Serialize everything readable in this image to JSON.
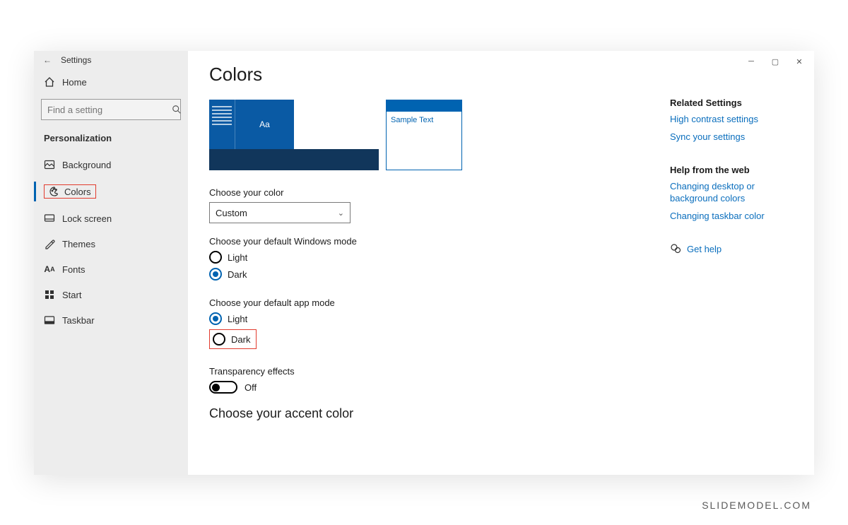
{
  "window": {
    "title": "Settings"
  },
  "sidebar": {
    "home": "Home",
    "search_placeholder": "Find a setting",
    "section": "Personalization",
    "items": [
      {
        "label": "Background"
      },
      {
        "label": "Colors",
        "selected": true,
        "highlighted": true
      },
      {
        "label": "Lock screen"
      },
      {
        "label": "Themes"
      },
      {
        "label": "Fonts"
      },
      {
        "label": "Start"
      },
      {
        "label": "Taskbar"
      }
    ]
  },
  "main": {
    "title": "Colors",
    "preview": {
      "tile_text": "Aa",
      "sample_text": "Sample Text"
    },
    "choose_color": {
      "label": "Choose your color",
      "value": "Custom"
    },
    "windows_mode": {
      "label": "Choose your default Windows mode",
      "options": [
        {
          "label": "Light",
          "selected": false
        },
        {
          "label": "Dark",
          "selected": true
        }
      ]
    },
    "app_mode": {
      "label": "Choose your default app mode",
      "options": [
        {
          "label": "Light",
          "selected": true,
          "highlighted": false
        },
        {
          "label": "Dark",
          "selected": false,
          "highlighted": true
        }
      ]
    },
    "transparency": {
      "label": "Transparency effects",
      "state": "Off"
    },
    "accent_heading": "Choose your accent color"
  },
  "right": {
    "related_heading": "Related Settings",
    "links": [
      "High contrast settings",
      "Sync your settings"
    ],
    "help_heading": "Help from the web",
    "help_links": [
      "Changing desktop or background colors",
      "Changing taskbar color"
    ],
    "get_help": "Get help"
  },
  "watermark": "SLIDEMODEL.COM"
}
